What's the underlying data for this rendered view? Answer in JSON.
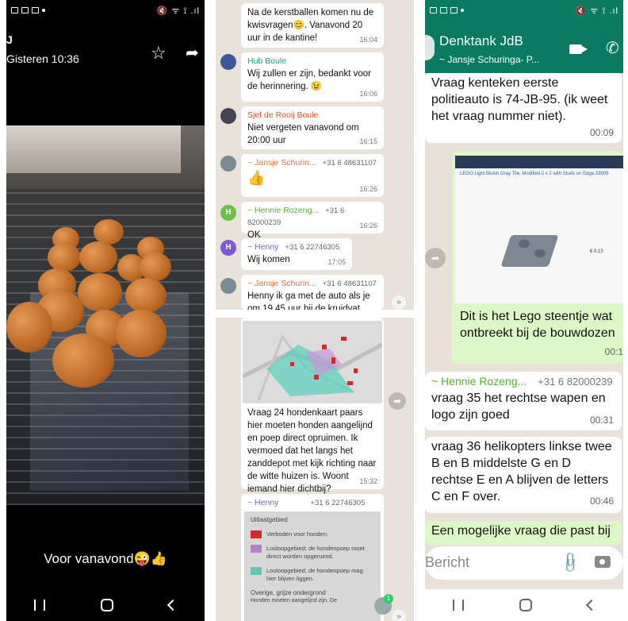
{
  "panel1": {
    "status_right": "🔇 ᯤ ⟟ .ıl",
    "header_name": "J",
    "header_time": "Gisteren 10:36",
    "star_icon": "star-icon",
    "share_icon": "share-icon",
    "caption": "Voor vanavond😜👍"
  },
  "panel2": {
    "messages": [
      {
        "text": "Na de kerstballen komen nu de kwisvragen😊. Vanavond 20 uur in de kantine!",
        "time": "16:04"
      },
      {
        "sender": "Hub Boule",
        "sender_color": "#1e9b7b",
        "text": "Wij zullen er zijn, bedankt voor de herinnering. 😉",
        "time": "16:06"
      },
      {
        "sender": "Sjef de Rooij Boule",
        "sender_color": "#d9531e",
        "text": "Niet vergeten vanavond om 20:00 uur",
        "time": "16:15"
      },
      {
        "sender": "~ Jansje Schurin...",
        "phone": "+31 6 48631107",
        "sender_color": "#e0703a",
        "text": "👍",
        "time": "16:26"
      },
      {
        "sender": "~ Hennie Rozeng...",
        "phone": "+31 6 82000239",
        "sender_color": "#57b22f",
        "avatar_letter": "H",
        "text": "OK",
        "time": "16:26"
      },
      {
        "sender": "~ Henny",
        "phone": "+31 6 22746305",
        "sender_color": "#8157d6",
        "avatar_letter": "H",
        "text": "Wij komen",
        "time": "17:05"
      },
      {
        "sender": "~ Jansje Schurin...",
        "phone": "+31 6 48631107",
        "sender_color": "#e0703a",
        "text": "Henny ik ga met de auto als je om 19.45 uur bij de kruidvat",
        "time": ""
      }
    ],
    "map_message": {
      "text": "Vraag 24 hondenkaart paars hier moeten honden aangelijnd en poep direct opruimen.  Ik vermoed dat het langs het zanddepot met kijk richting naar de witte huizen is.  Woont iemand hier dichtbij?",
      "time": "15:32"
    },
    "henny_message": {
      "sender": "~ Henny",
      "phone": "+31 6 22746305"
    },
    "legend": {
      "title": "Uitlaatgebied",
      "items": [
        {
          "label": "Verboden voor honden.",
          "color": "#d12a2a"
        },
        {
          "label": "Losloopgebied; de hondenpoep moet direct worden opgeruimd.",
          "color": "#b77fc6"
        },
        {
          "label": "Losloopgebied; de hondenpoep mag hier blijven liggen.",
          "color": "#5fc7b4"
        }
      ],
      "footer": "Overige, grijze ondergrond",
      "footer2": "Honden moeten aangelijnd zijn. De"
    },
    "unread_badge": "1"
  },
  "panel3": {
    "title": "Denktank JdB",
    "subtitle": "~ Jansje Schuringa- P...",
    "messages": [
      {
        "text": "Vraag kenteken eerste politieauto  is 74-JB-95. (ik weet het vraag nummer niet).",
        "time": "00:09"
      },
      {
        "text": "Dit is het Lego steentje wat ontbreekt bij de bouwdozen",
        "time": "00:1"
      },
      {
        "sender": "~ Hennie Rozeng...",
        "phone": "+31 6 82000239",
        "text": "vraag 35 het rechtse wapen en logo zijn goed",
        "time": "00:31"
      },
      {
        "text": "vraag 36 helikopters linkse twee B en B middelste G en D rechtse E en A blijven de letters C en F over.",
        "time": "00:46"
      },
      {
        "text": "Een mogelijke vraag die past bij"
      }
    ],
    "lego_page_title": "LEGO Light Bluish Gray Tile, Modified 2 x 2 with Studs on Edge 33909",
    "lego_price": "€ 0,13",
    "input_placeholder": "Bericht",
    "accent_color": "#0b7a62"
  }
}
